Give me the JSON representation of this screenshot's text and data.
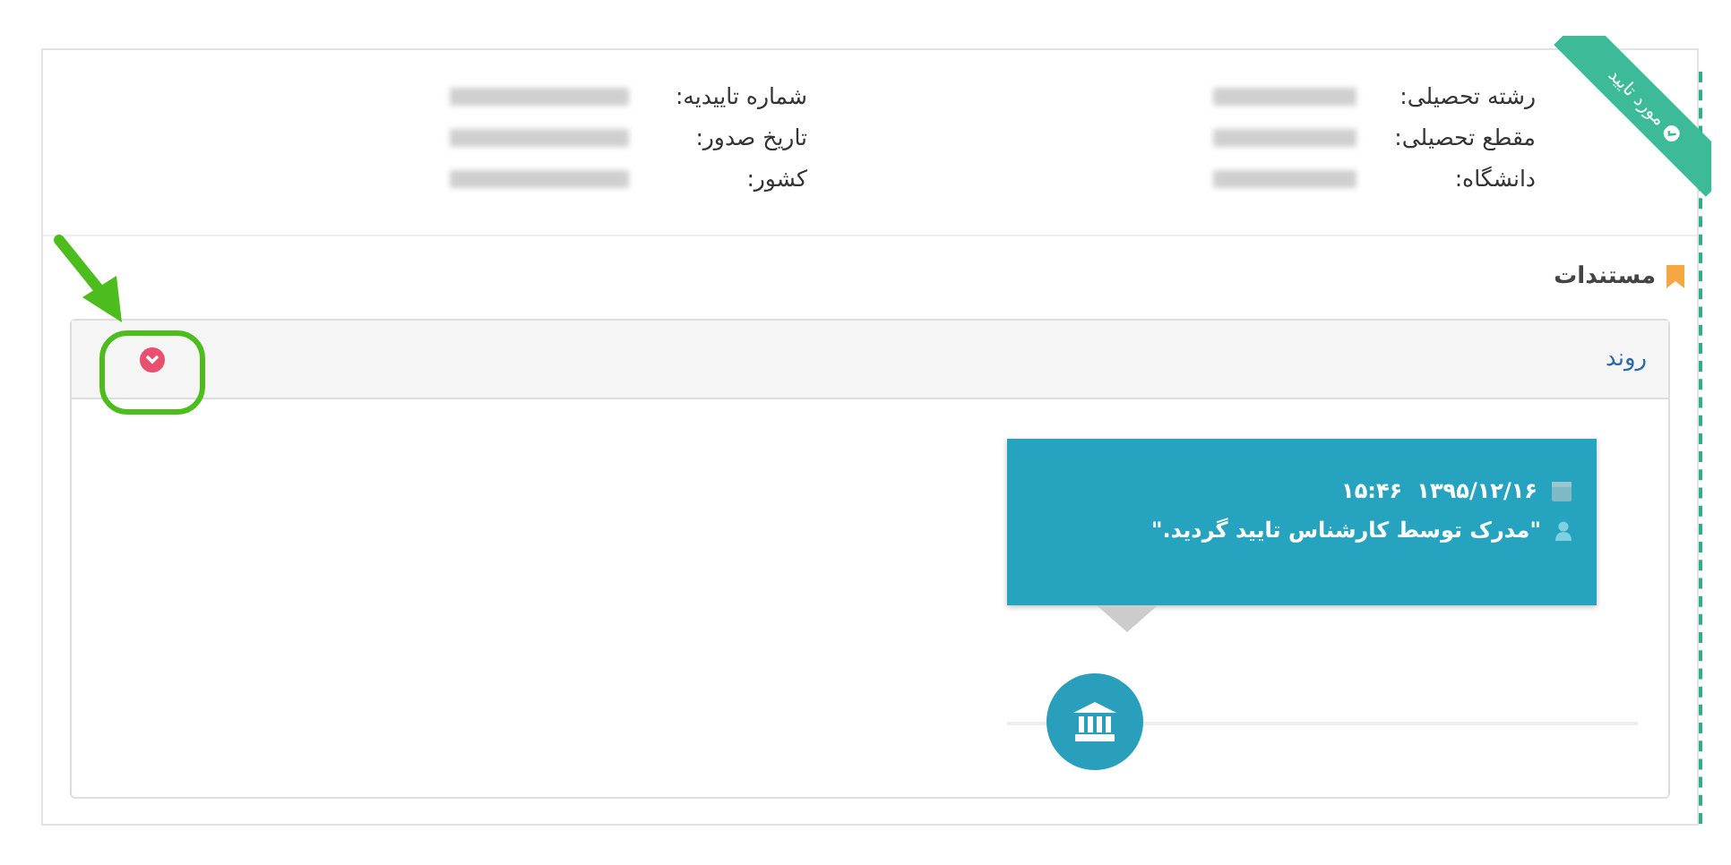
{
  "badge": {
    "label": "مورد تایید"
  },
  "details": [
    {
      "label": "رشته تحصیلی:"
    },
    {
      "label": "شماره تاییدیه:"
    },
    {
      "label": "مقطع تحصیلی:"
    },
    {
      "label": "تاریخ صدور:"
    },
    {
      "label": "دانشگاه:"
    },
    {
      "label": "کشور:"
    }
  ],
  "section": {
    "title": "مستندات"
  },
  "panel": {
    "title": "روند",
    "expanded": true
  },
  "timeline": [
    {
      "date": "۱۳۹۵/۱۲/۱۶",
      "time": "۱۵:۴۶",
      "message": "\"مدرک توسط کارشناس تایید گردید.\""
    }
  ]
}
